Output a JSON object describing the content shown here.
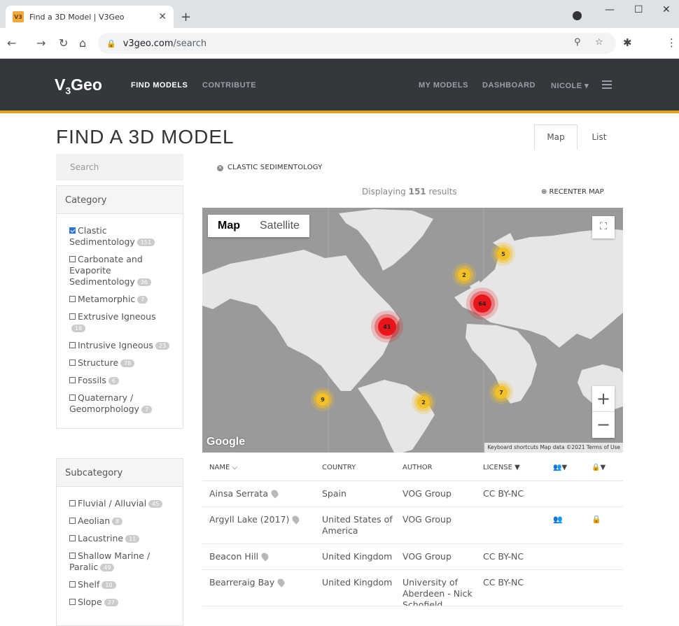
{
  "browser": {
    "tab_title": "Find a 3D Model | V3Geo",
    "tab_favicon": "V3",
    "url_host": "v3geo.com",
    "url_path": "/search"
  },
  "site": {
    "logo_main": "V",
    "logo_sub": "3",
    "logo_rest": "Geo",
    "nav": {
      "find_models": "FIND MODELS",
      "contribute": "CONTRIBUTE",
      "my_models": "MY MODELS",
      "dashboard": "DASHBOARD",
      "user": "NICOLE ▾"
    }
  },
  "page": {
    "title": "FIND A 3D MODEL",
    "view_tabs": [
      "Map",
      "List"
    ],
    "search_placeholder": "Search",
    "active_filter": "CLASTIC SEDIMENTOLOGY",
    "results_prefix": "Displaying ",
    "results_count": "151",
    "results_suffix": " results",
    "recenter": "⊕ RECENTER MAP"
  },
  "category": {
    "heading": "Category",
    "options": [
      {
        "label": "Clastic Sedimentology",
        "count": "151",
        "checked": true
      },
      {
        "label": "Carbonate and Evaporite Sedimentology",
        "count": "36",
        "checked": false
      },
      {
        "label": "Metamorphic",
        "count": "7",
        "checked": false
      },
      {
        "label": "Extrusive Igneous",
        "count": "18",
        "checked": false
      },
      {
        "label": "Intrusive Igneous",
        "count": "23",
        "checked": false
      },
      {
        "label": "Structure",
        "count": "78",
        "checked": false
      },
      {
        "label": "Fossils",
        "count": "6",
        "checked": false
      },
      {
        "label": "Quaternary / Geomorphology",
        "count": "7",
        "checked": false
      }
    ]
  },
  "subcategory": {
    "heading": "Subcategory",
    "options": [
      {
        "label": "Fluvial / Alluvial",
        "count": "45"
      },
      {
        "label": "Aeolian",
        "count": "8"
      },
      {
        "label": "Lacustrine",
        "count": "11"
      },
      {
        "label": "Shallow Marine / Paralic",
        "count": "49"
      },
      {
        "label": "Shelf",
        "count": "10"
      },
      {
        "label": "Slope",
        "count": "27"
      }
    ]
  },
  "map": {
    "type_map": "Map",
    "type_satellite": "Satellite",
    "google": "Google",
    "attribution": "Keyboard shortcuts   Map data ©2021   Terms of Use",
    "zoom_in": "+",
    "zoom_out": "−",
    "clusters": [
      "5",
      "2",
      "64",
      "41",
      "9",
      "2",
      "7"
    ]
  },
  "table": {
    "headers": {
      "name": "NAME ⌵",
      "country": "COUNTRY",
      "author": "AUTHOR",
      "license": "LICENSE ▼",
      "group": "👥▼",
      "lock": "🔒▼"
    },
    "rows": [
      {
        "name": "Ainsa Serrata",
        "country": "Spain",
        "author": "VOG Group",
        "license": "CC BY-NC",
        "group": "",
        "lock": ""
      },
      {
        "name": "Argyll Lake (2017)",
        "country": "United States of America",
        "author": "VOG Group",
        "license": "",
        "group": "👥",
        "lock": "🔒"
      },
      {
        "name": "Beacon Hill",
        "country": "United Kingdom",
        "author": "VOG Group",
        "license": "CC BY-NC",
        "group": "",
        "lock": ""
      },
      {
        "name": "Bearreraig Bay",
        "country": "United Kingdom",
        "author": "University of Aberdeen - Nick Schofield",
        "license": "CC BY-NC",
        "group": "",
        "lock": ""
      }
    ]
  }
}
